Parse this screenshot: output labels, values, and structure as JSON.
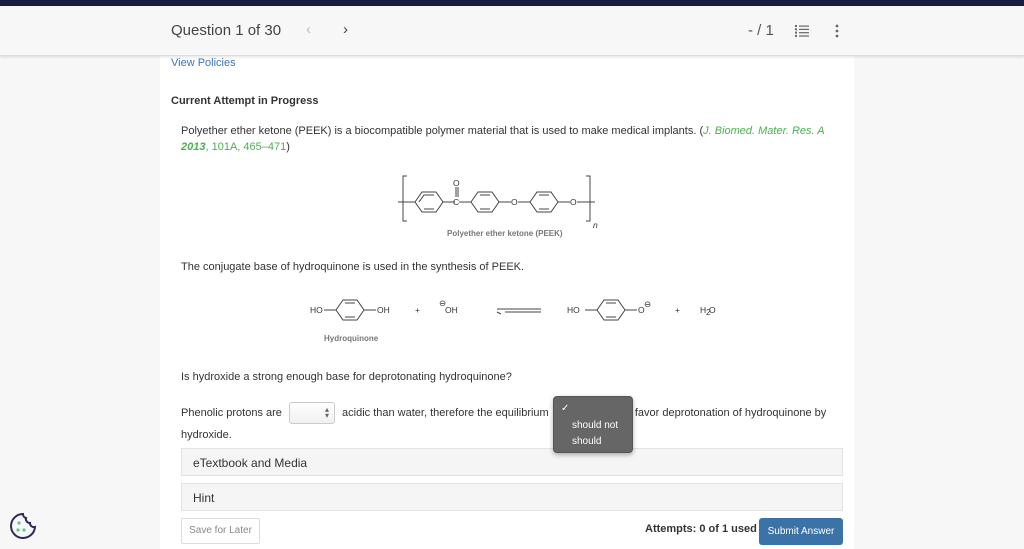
{
  "header": {
    "question_label": "Question 1 of 30",
    "prev_icon": "chevron-left-icon",
    "next_icon": "chevron-right-icon",
    "prev_glyph": "‹",
    "next_glyph": "›",
    "score": "- / 1",
    "list_icon": "list-icon",
    "more_icon": "more-vertical-icon"
  },
  "links": {
    "view_policies": "View Policies"
  },
  "attempt_heading": "Current Attempt in Progress",
  "intro": {
    "text": "Polyether ether ketone (PEEK) is a biocompatible polymer material that is used to make medical implants. (",
    "citation_journal": "J. Biomed. Mater. Res. A",
    "citation_year": "2013",
    "citation_rest": ", 101A, 465–471",
    "close": ")"
  },
  "figure1": {
    "caption": "Polyether ether ketone (PEEK)",
    "atom_o_carbonyl": "O",
    "atom_c": "C",
    "atom_o1": "O",
    "atom_o2": "O",
    "subscript_n": "n"
  },
  "conjugate_text": "The conjugate base of hydroquinone is used in the synthesis of PEEK.",
  "figure2": {
    "caption": "Hydroquinone",
    "ho_left": "HO",
    "oh_right": "OH",
    "plus1": "+",
    "hydroxide": "OH",
    "ho_product": "HO",
    "o_minus": "O",
    "plus2": "+",
    "water": "H",
    "water_sub": "2",
    "water_o": "O",
    "charge": "⊖"
  },
  "question_text": "Is hydroxide a strong enough base for deprotonating hydroquinone?",
  "fill_in": {
    "part1": "Phenolic protons are",
    "select1_value": "",
    "part2": "acidic than water, therefore the equilibrium",
    "part3": "favor deprotonation of hydroquinone by",
    "part4": "hydroxide."
  },
  "dropdown": {
    "checked": "✓",
    "options": [
      "should not",
      "should"
    ]
  },
  "accordions": {
    "etextbook": "eTextbook and Media",
    "hint": "Hint"
  },
  "footer": {
    "save_label": "Save for Later",
    "attempts": "Attempts: 0 of 1 used",
    "submit_label": "Submit Answer"
  },
  "cookie_icon": "cookie-icon"
}
